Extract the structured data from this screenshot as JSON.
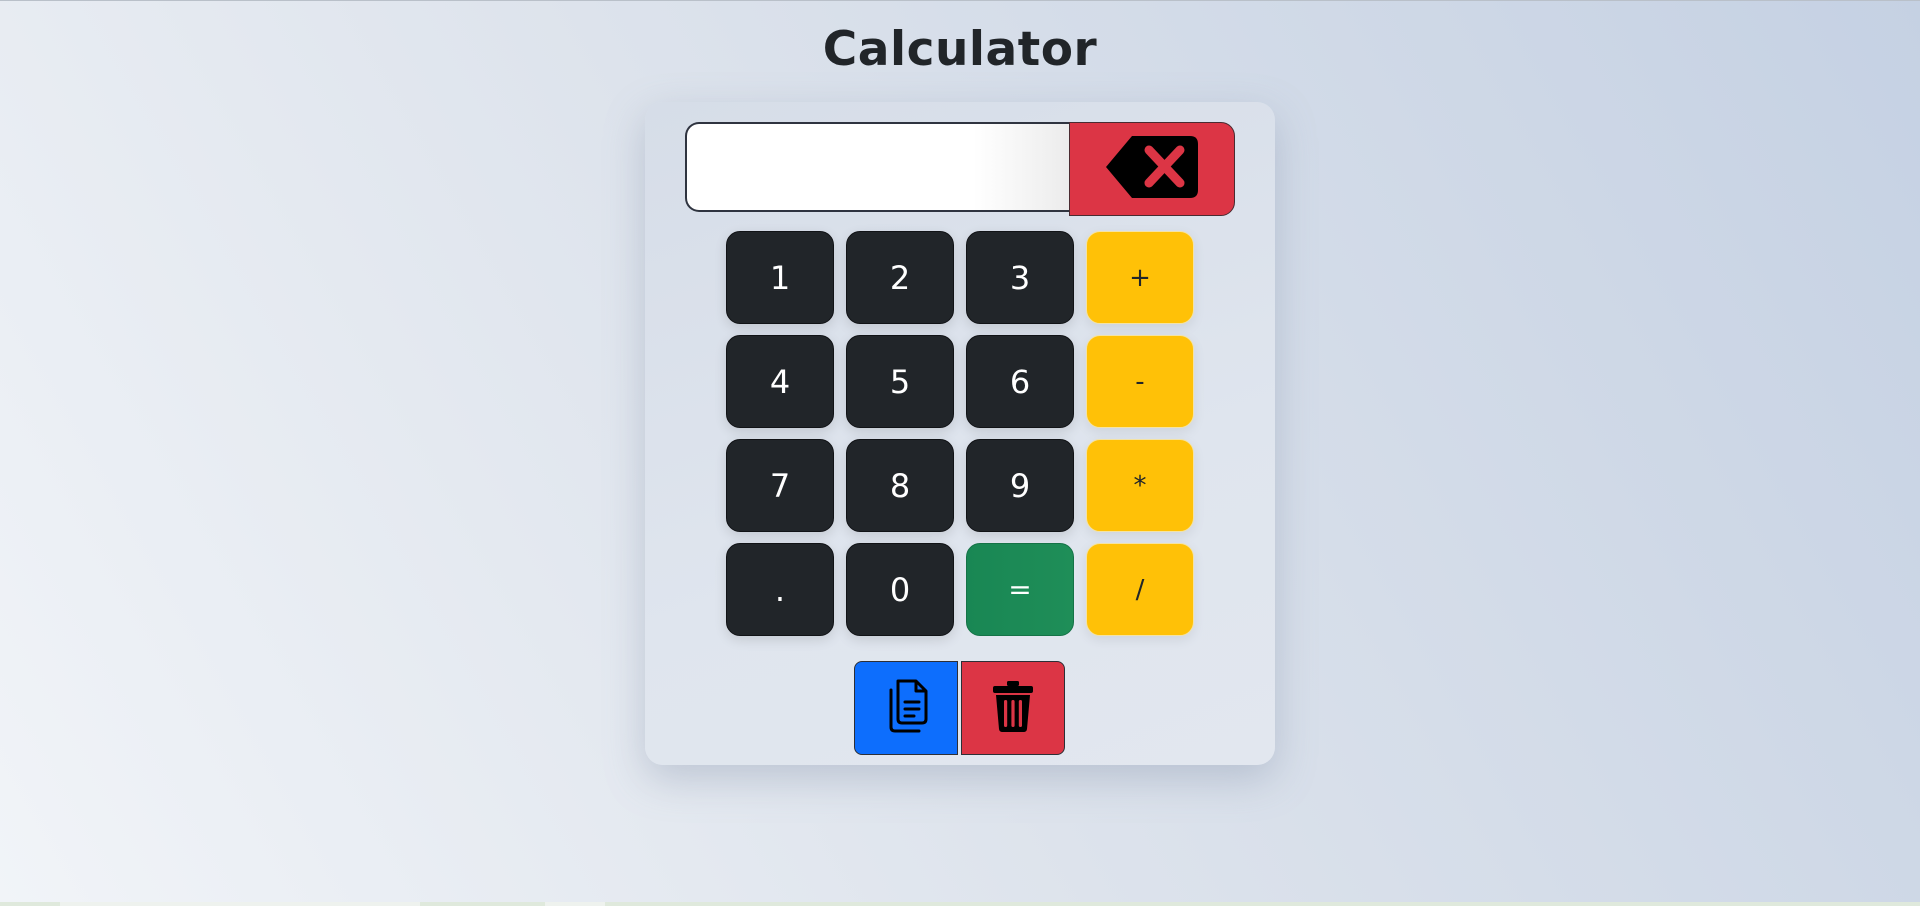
{
  "page": {
    "title": "Calculator"
  },
  "display": {
    "value": "",
    "placeholder": ""
  },
  "icons": {
    "backspace": "backspace-icon",
    "copy": "copy-icon",
    "clear": "trash-icon"
  },
  "keypad": {
    "rows": [
      [
        "1",
        "2",
        "3",
        "+"
      ],
      [
        "4",
        "5",
        "6",
        "-"
      ],
      [
        "7",
        "8",
        "9",
        "*"
      ],
      [
        ".",
        "0",
        "=",
        "/"
      ]
    ]
  },
  "colors": {
    "digit": "#212529",
    "operator": "#ffc107",
    "equals": "#198754",
    "backspace": "#dc3545",
    "copy": "#0d6efd",
    "clear": "#dc3545"
  }
}
